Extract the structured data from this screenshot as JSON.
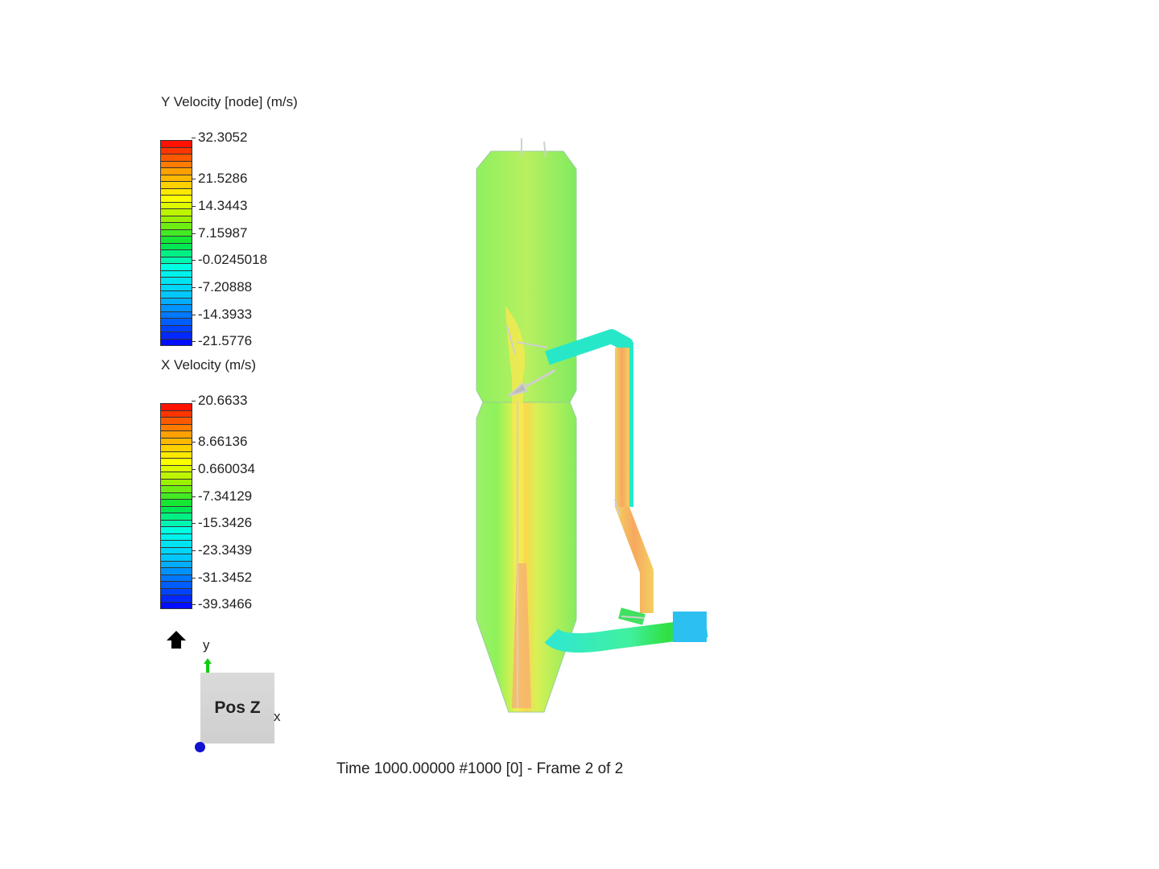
{
  "legends": [
    {
      "title": "Y Velocity [node] (m/s)",
      "ticks": [
        "32.3052",
        "21.5286",
        "14.3443",
        "7.15987",
        "-0.0245018",
        "-7.20888",
        "-14.3933",
        "-21.5776"
      ]
    },
    {
      "title": "X Velocity (m/s)",
      "ticks": [
        "20.6633",
        "8.66136",
        "0.660034",
        "-7.34129",
        "-15.3426",
        "-23.3439",
        "-31.3452",
        "-39.3466"
      ]
    }
  ],
  "orientation": {
    "cube_label": "Pos Z",
    "axis_y": "y",
    "axis_x": "x",
    "home_icon": "home-icon"
  },
  "status": "Time 1000.00000  #1000 [0] - Frame 2 of 2",
  "colors": {
    "column_base": "#7dec5a",
    "core": "#f5e94a",
    "pipe_hot": "#f6b85a",
    "pipe_cold": "#24e6e0"
  }
}
